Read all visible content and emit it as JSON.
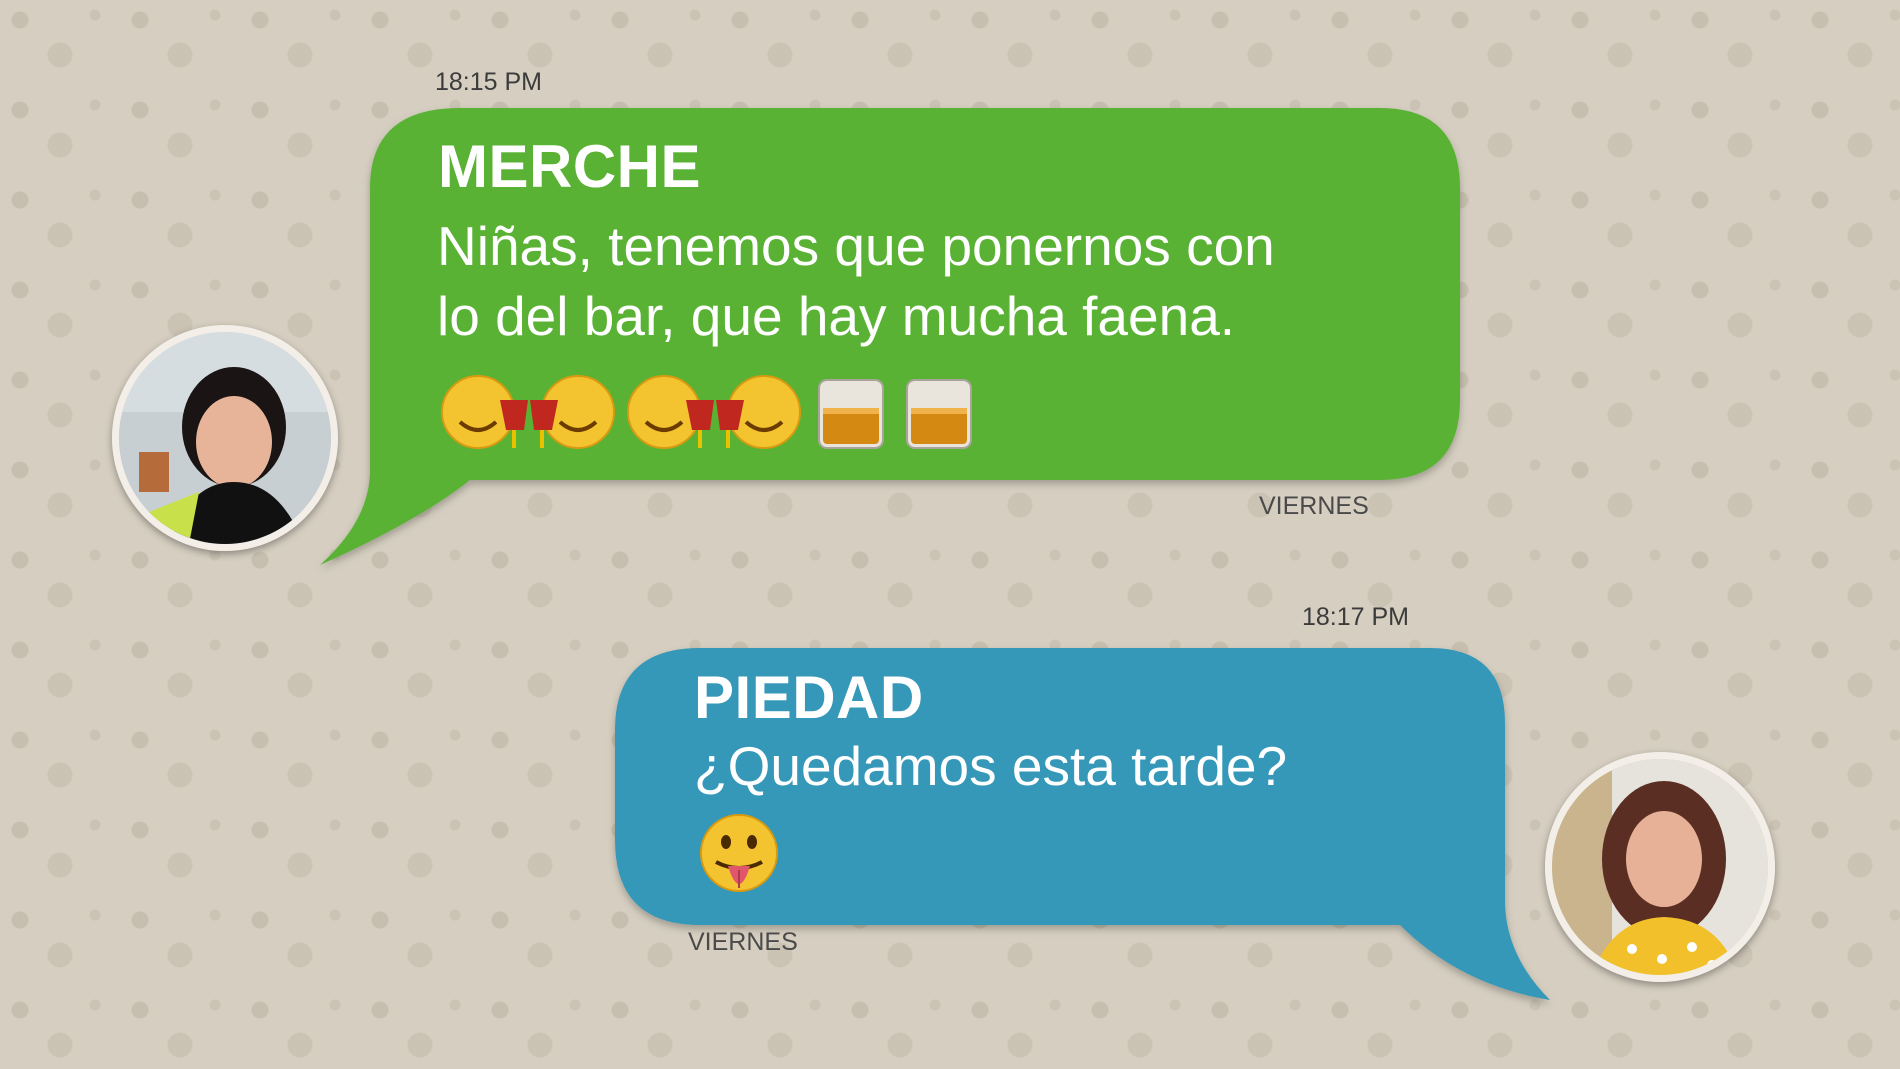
{
  "messages": [
    {
      "time": "18:15 PM",
      "sender": "MERCHE",
      "lines": [
        "Niñas, tenemos que ponernos con",
        "lo del bar, que hay mucha faena."
      ],
      "emojis": [
        "clinking-faces-emoji",
        "clinking-faces-emoji",
        "whisky-glass-emoji",
        "whisky-glass-emoji"
      ],
      "day": "VIERNES",
      "color": "#5ab236"
    },
    {
      "time": "18:17 PM",
      "sender": "PIEDAD",
      "lines": [
        "¿Quedamos esta tarde?"
      ],
      "emojis": [
        "tongue-out-face-emoji"
      ],
      "day": "VIERNES",
      "color": "#3698b8"
    }
  ],
  "colors": {
    "background": "#d6cfc1",
    "text": "#ffffff",
    "avatar_border": "#f3efe8"
  }
}
